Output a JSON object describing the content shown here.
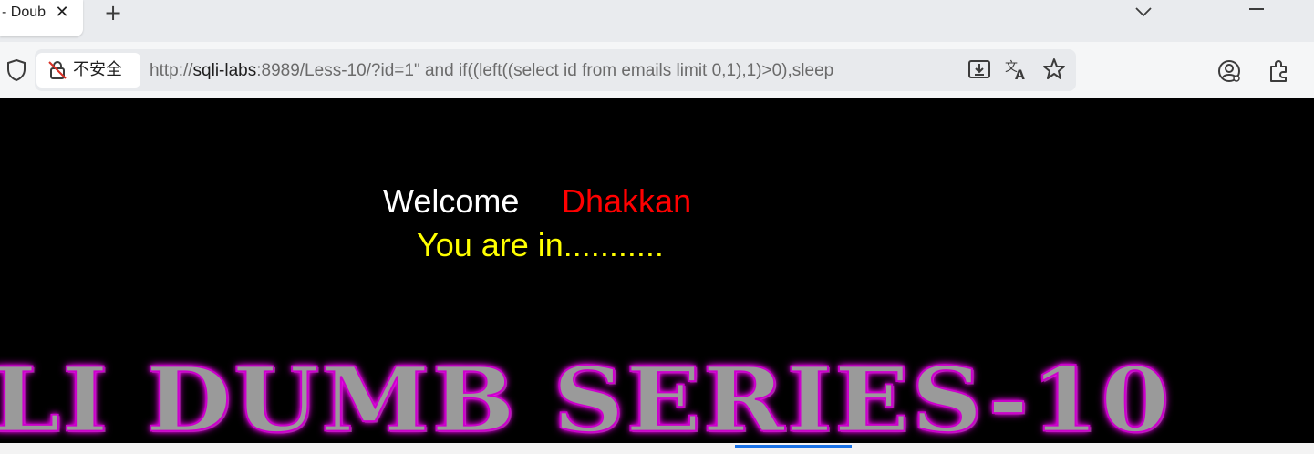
{
  "browser": {
    "tab": {
      "title": "- Doub"
    },
    "security_label": "不安全",
    "url": {
      "scheme": "http://",
      "host": "sqli-labs",
      "rest": ":8989/Less-10/?id=1\" and if((left((select id from emails limit 0,1),1)>0),sleep"
    },
    "icons": [
      "shield-icon",
      "not-secure-lock-icon",
      "download-icon",
      "translate-icon",
      "star-icon",
      "profile-icon",
      "extensions-icon",
      "tab-close-icon",
      "new-tab-icon",
      "tab-search-chevron-icon",
      "minimize-icon"
    ]
  },
  "page": {
    "welcome": "Welcome",
    "name": "Dhakkan",
    "status": "You are in...........",
    "banner": "LI DUMB SERIES-10",
    "colors": {
      "welcome": "#ffffff",
      "name": "#ff0000",
      "status": "#ffff00",
      "banner_glow": "#ff00ff",
      "background": "#000000"
    }
  }
}
